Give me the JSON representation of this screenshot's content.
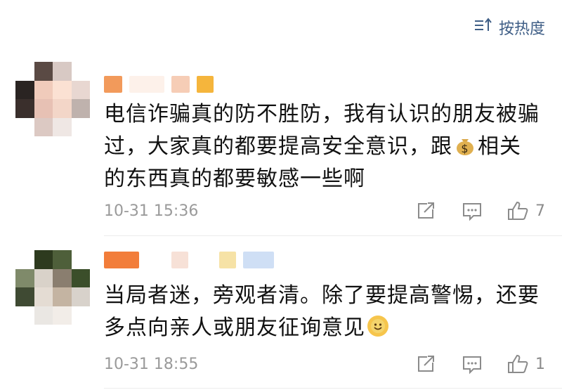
{
  "sort": {
    "label": "按热度",
    "icon": "sort-icon"
  },
  "comments": [
    {
      "text_lines": [
        "电信诈骗真的防不胜防，我有认识的朋友被骗",
        "过，大家真的都要提高安全意识，跟",
        "相关",
        "的东西真的都要敏感一些啊"
      ],
      "inline_emoji": "money-bag-icon",
      "timestamp": "10-31 15:36",
      "likes": "7"
    },
    {
      "text_lines": [
        "当局者迷，旁观者清。除了要提高警惕，还要",
        "多点向亲人或朋友征询意见"
      ],
      "inline_emoji": "smile-flower-icon",
      "timestamp": "10-31 18:55",
      "likes": "1"
    }
  ],
  "colors": {
    "accent": "#3f5e86",
    "meta": "#9a9a9a"
  }
}
